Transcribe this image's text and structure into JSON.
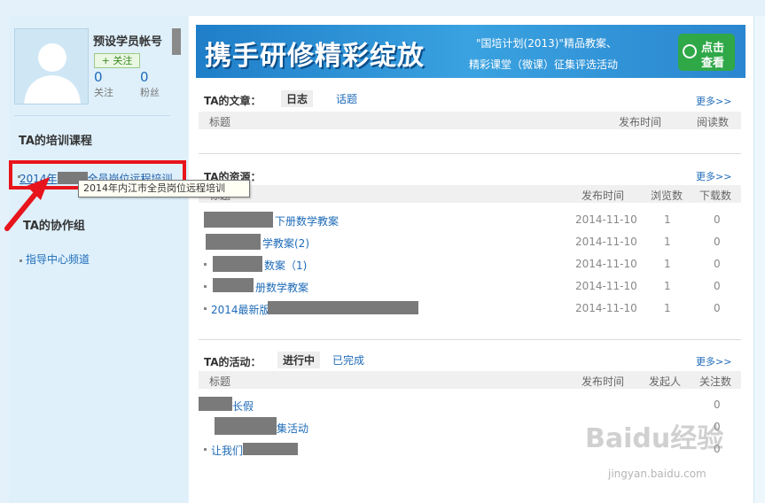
{
  "profile": {
    "username": "预设学员帐号",
    "follow_label": "+ 关注",
    "following_count": "0",
    "following_label": "关注",
    "fans_count": "0",
    "fans_label": "粉丝"
  },
  "sidebar": {
    "courses_heading": "TA的培训课程",
    "course_prefix": "2014年",
    "course_suffix": "全员岗位远程培训",
    "tooltip": "2014年内江市全员岗位远程培训",
    "groups_heading": "TA的协作组",
    "group_link": "指导中心频道"
  },
  "banner": {
    "title": "携手研修精彩绽放",
    "line1": "\"国培计划(2013)\"精品教案、",
    "line2": "精彩课堂（微课）征集评选活动",
    "button_line1": "点击",
    "button_line2": "查看"
  },
  "articles": {
    "title": "TA的文章：",
    "tabs": [
      {
        "label": "日志"
      },
      {
        "label": "话题"
      }
    ],
    "more": "更多>>",
    "columns": [
      "标题",
      "发布时间",
      "阅读数"
    ]
  },
  "resources": {
    "title": "TA的资源：",
    "more": "更多>>",
    "columns": [
      "标题",
      "发布时间",
      "浏览数",
      "下载数"
    ],
    "rows": [
      {
        "title": "下册数学教案",
        "date": "2014-11-10",
        "views": "1",
        "downloads": "0"
      },
      {
        "title": "学教案(2)",
        "date": "2014-11-10",
        "views": "1",
        "downloads": "0"
      },
      {
        "title": "数案（1)",
        "date": "2014-11-10",
        "views": "1",
        "downloads": "0"
      },
      {
        "title": "册数学教案",
        "date": "2014-11-10",
        "views": "1",
        "downloads": "0"
      },
      {
        "title": "2014最新版",
        "date": "2014-11-10",
        "views": "1",
        "downloads": "0"
      }
    ]
  },
  "activities": {
    "title": "TA的活动：",
    "tabs": [
      {
        "label": "进行中"
      },
      {
        "label": "已完成"
      }
    ],
    "more": "更多>>",
    "columns": [
      "标题",
      "发布时间",
      "发起人",
      "关注数"
    ],
    "rows": [
      {
        "title": "长假",
        "count": "0"
      },
      {
        "title": "集活动",
        "count": "0"
      },
      {
        "title": "让我们",
        "count": "0"
      }
    ]
  },
  "watermark": {
    "text": "Baidu经验",
    "url": "jingyan.baidu.com"
  },
  "colors": {
    "link": "#1e6bb8",
    "highlight_red": "#e8141c",
    "sidebar_bg": "#dff0fb"
  }
}
